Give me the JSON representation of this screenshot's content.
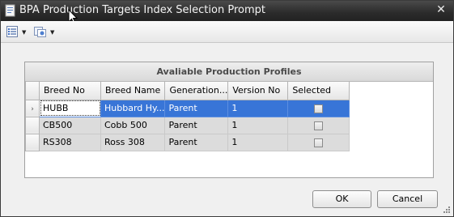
{
  "window": {
    "title": "BPA Production Targets Index Selection Prompt",
    "close_glyph": "✕",
    "title_icon": "document-icon"
  },
  "toolbar": {
    "items": [
      {
        "icon": "list-icon",
        "dropdown_glyph": "▼"
      },
      {
        "icon": "layout-icon",
        "dropdown_glyph": "▼"
      }
    ]
  },
  "grid": {
    "caption": "Avaliable Production Profiles",
    "columns": [
      "Breed No",
      "Breed Name",
      "Generation...",
      "Version No",
      "Selected"
    ],
    "rows": [
      {
        "breed_no": "HUBB",
        "breed_name": "Hubbard Hy...",
        "generation": "Parent",
        "version_no": "1",
        "selected": false
      },
      {
        "breed_no": "CB500",
        "breed_name": "Cobb 500",
        "generation": "Parent",
        "version_no": "1",
        "selected": false
      },
      {
        "breed_no": "RS308",
        "breed_name": "Ross 308",
        "generation": "Parent",
        "version_no": "1",
        "selected": false
      }
    ],
    "active_row_indicator": "›"
  },
  "buttons": {
    "ok": "OK",
    "cancel": "Cancel"
  },
  "colors": {
    "selection": "#3875d7",
    "titlebar": "#2b2b2b"
  }
}
